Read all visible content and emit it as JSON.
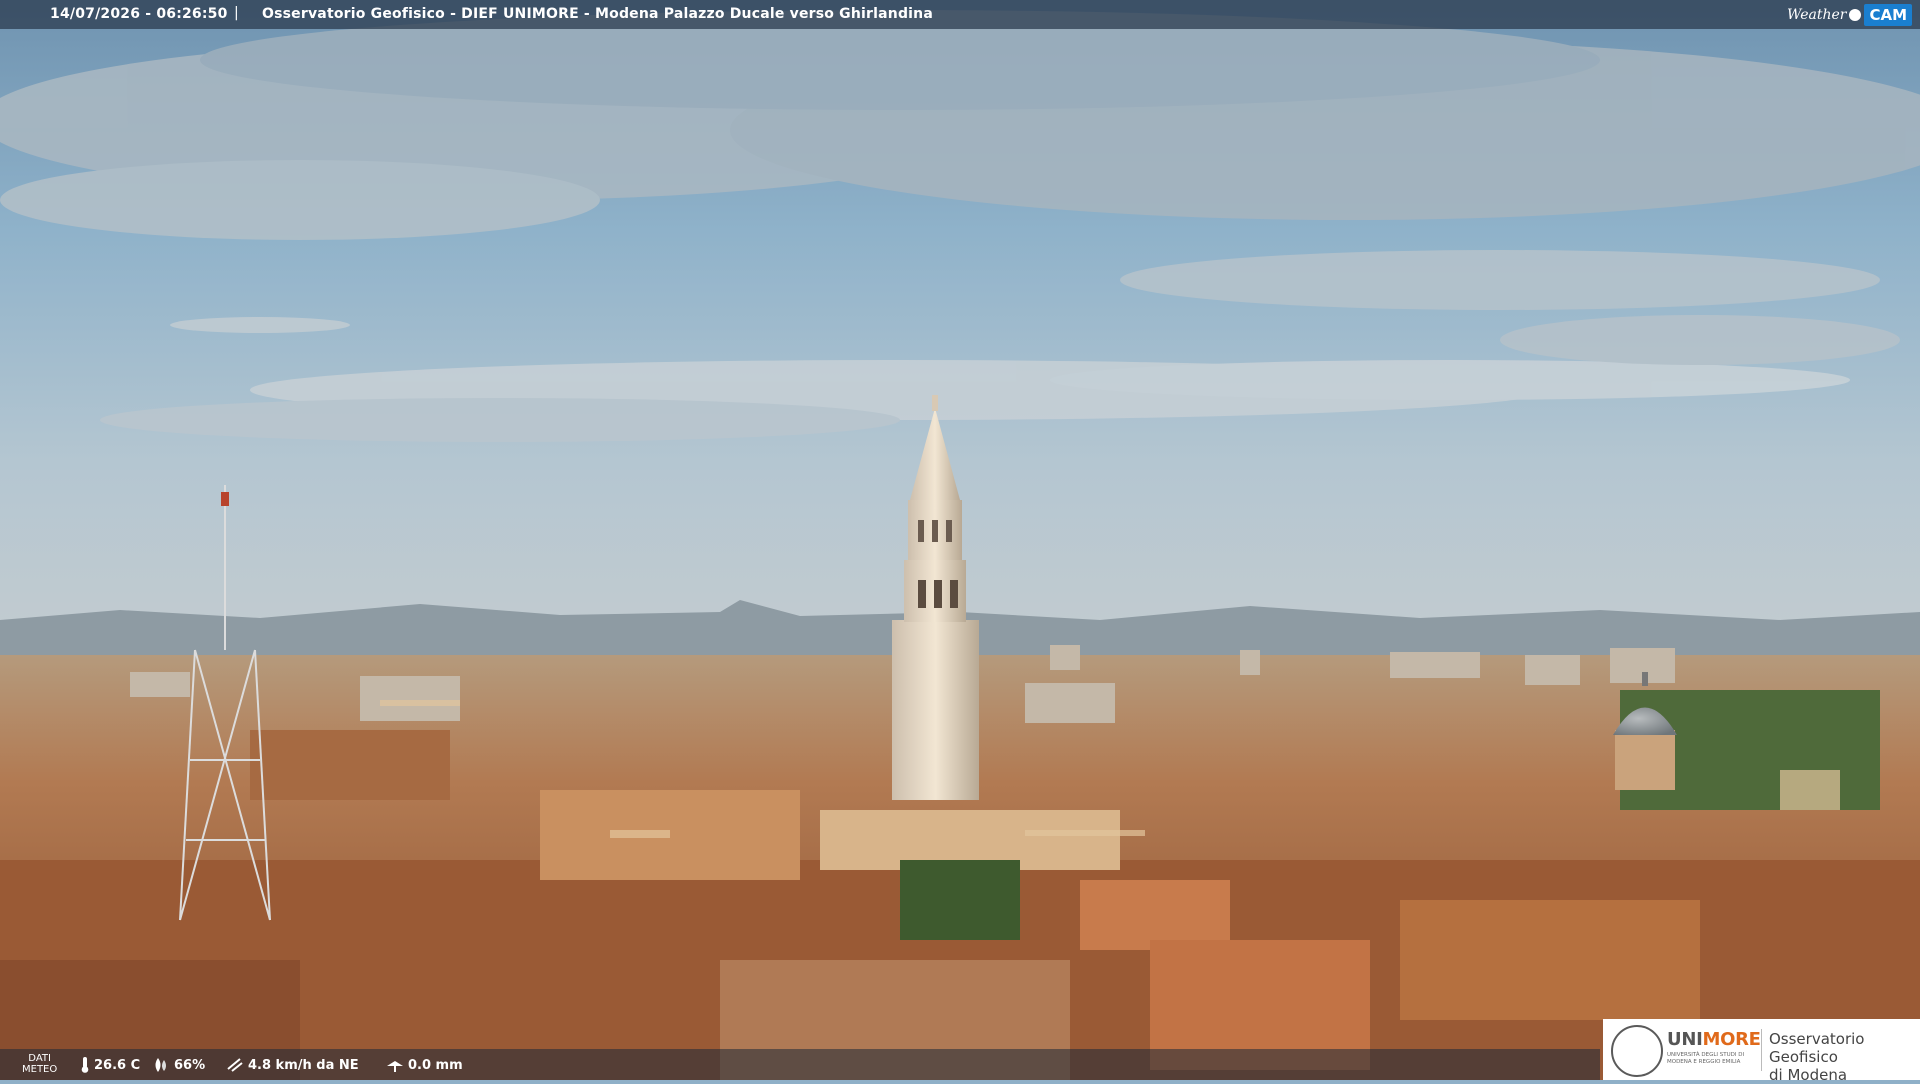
{
  "header": {
    "timestamp": "14/07/2026 - 06:26:50",
    "separator": "|",
    "title": "Osservatorio Geofisico - DIEF UNIMORE - Modena Palazzo Ducale verso Ghirlandina",
    "brand_weather": "Weather",
    "brand_cam": "CAM"
  },
  "weather": {
    "label_line1": "DATI",
    "label_line2": "METEO",
    "temperature": "26.6 C",
    "humidity": "66%",
    "wind": "4.8 km/h da NE",
    "rain": "0.0 mm"
  },
  "logo": {
    "brand_grey": "UNI",
    "brand_orange": "MORE",
    "subtitle": "UNIVERSITÀ DEGLI STUDI DI MODENA E REGGIO EMILIA",
    "observatory_line1": "Osservatorio Geofisico",
    "observatory_line2": "di Modena"
  },
  "icons": {
    "temperature": "thermometer-icon",
    "humidity": "droplet-icon",
    "wind": "wind-icon",
    "rain": "rain-gauge-icon",
    "cam": "camera-dot-icon"
  },
  "colors": {
    "sky_top": "#7fa2bd",
    "sky_bottom": "#c9d6dc",
    "roofs": "#b8703f",
    "tower": "#e9dccb",
    "accent_orange": "#e06a1b",
    "cam_blue": "#1a7fd0"
  }
}
